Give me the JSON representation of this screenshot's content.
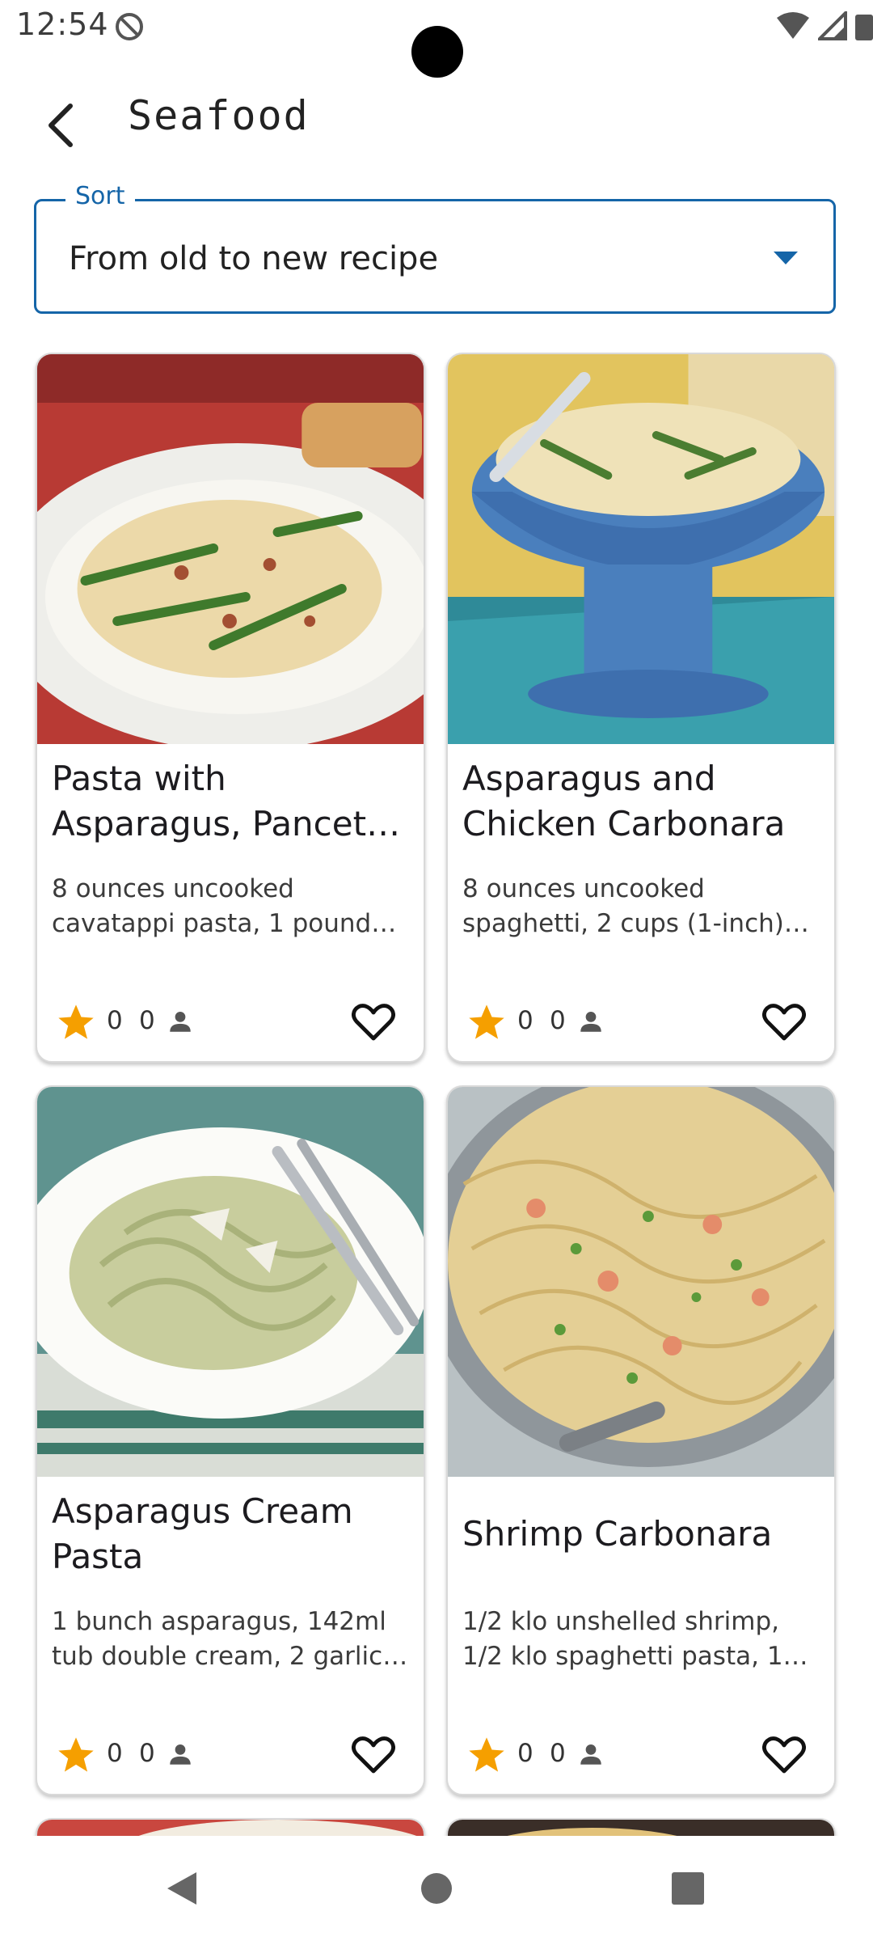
{
  "status_bar": {
    "time": "12:54"
  },
  "app_bar": {
    "title": "Seafood"
  },
  "sort": {
    "label": "Sort",
    "value": "From old to new recipe"
  },
  "recipes": [
    {
      "title": "Pasta with Asparagus, Pancetta, and Pine N...",
      "description": "8 ounces uncooked cavatappi pasta, 1 pound asparagus, t...",
      "rating": "0",
      "users": "0",
      "image": "pasta-asparagus-pancetta-photo"
    },
    {
      "title": "Asparagus and Chicken Carbonara",
      "description": "8 ounces uncooked spaghetti, 2 cups (1-inch) sli...",
      "rating": "0",
      "users": "0",
      "image": "chicken-carbonara-photo"
    },
    {
      "title": "Asparagus Cream Pasta",
      "description": "1 bunch asparagus, 142ml tub double cream, 2 garlic cl...",
      "rating": "0",
      "users": "0",
      "image": "asparagus-cream-pasta-photo"
    },
    {
      "title": "Shrimp Carbonara",
      "description": "1/2 klo unshelled shrimp, 1/2 klo spaghetti pasta, 1 ca...",
      "rating": "0",
      "users": "0",
      "image": "shrimp-carbonara-photo"
    }
  ],
  "colors": {
    "accent": "#1565a8",
    "star": "#f59f00",
    "card_border": "#d9d9d9"
  },
  "icons": {
    "back": "arrow-back-icon",
    "dropdown": "dropdown-arrow-icon",
    "star": "star-icon",
    "user": "person-icon",
    "favorite": "heart-outline-icon"
  }
}
